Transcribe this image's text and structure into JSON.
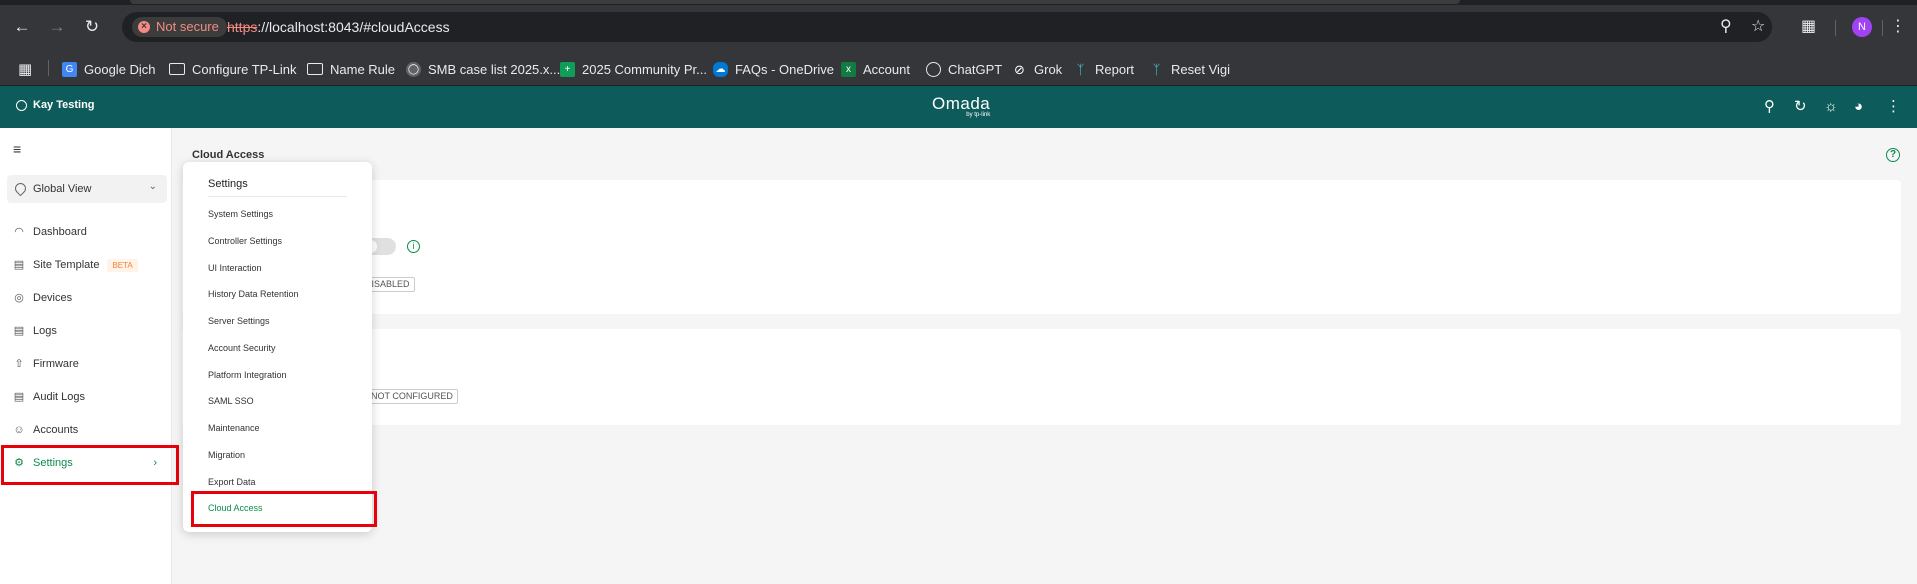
{
  "browser": {
    "not_secure": "Not secure",
    "url_scheme": "https",
    "url_rest": "://localhost:8043/#cloudAccess",
    "profile_initial": "N",
    "bookmarks": [
      {
        "label": "Google Dịch"
      },
      {
        "label": "Configure TP-Link"
      },
      {
        "label": "Name Rule"
      },
      {
        "label": "SMB case list 2025.x..."
      },
      {
        "label": "2025 Community Pr..."
      },
      {
        "label": "FAQs - OneDrive"
      },
      {
        "label": "Account"
      },
      {
        "label": "ChatGPT"
      },
      {
        "label": "Grok"
      },
      {
        "label": "Report"
      },
      {
        "label": "Reset Vigi"
      }
    ]
  },
  "header": {
    "site_name": "Kay Testing",
    "logo": "Omada",
    "logo_sub": "by tp-link"
  },
  "sidebar": {
    "scope": "Global View",
    "items": [
      {
        "label": "Dashboard"
      },
      {
        "label": "Site Template",
        "badge": "BETA"
      },
      {
        "label": "Devices"
      },
      {
        "label": "Logs"
      },
      {
        "label": "Firmware"
      },
      {
        "label": "Audit Logs"
      },
      {
        "label": "Accounts"
      },
      {
        "label": "Settings",
        "active": true
      }
    ]
  },
  "main": {
    "title": "Cloud Access",
    "card1_status": "DISABLED",
    "card2_status": "NOT CONFIGURED"
  },
  "menu": {
    "title": "Settings",
    "items": [
      {
        "label": "System Settings"
      },
      {
        "label": "Controller Settings"
      },
      {
        "label": "UI Interaction"
      },
      {
        "label": "History Data Retention"
      },
      {
        "label": "Server Settings"
      },
      {
        "label": "Account Security"
      },
      {
        "label": "Platform Integration"
      },
      {
        "label": "SAML SSO"
      },
      {
        "label": "Maintenance"
      },
      {
        "label": "Migration"
      },
      {
        "label": "Export Data"
      },
      {
        "label": "Cloud Access",
        "selected": true
      }
    ]
  },
  "colors": {
    "header_bg": "#0e5b5b",
    "accent": "#0c8b4b",
    "highlight": "#e8000b"
  }
}
